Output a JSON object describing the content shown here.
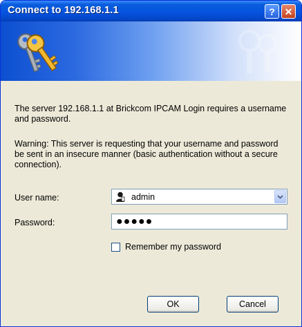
{
  "window": {
    "title": "Connect to 192.168.1.1",
    "help_glyph": "?",
    "close_glyph": "✕"
  },
  "banner": {
    "icon": "keys-icon"
  },
  "message": {
    "line1": "The server 192.168.1.1 at Brickcom IPCAM Login requires a username and password.",
    "warning": "Warning: This server is requesting that your username and password be sent in an insecure manner (basic authentication without a secure connection)."
  },
  "form": {
    "user_label": "User name:",
    "user_value": "admin",
    "password_label": "Password:",
    "password_value": "●●●●●",
    "remember_label": "Remember my password",
    "remember_checked": false
  },
  "buttons": {
    "ok": "OK",
    "cancel": "Cancel"
  },
  "colors": {
    "title_bar": "#0654e0",
    "dialog_bg": "#ece9d8",
    "close_button": "#c3421d"
  }
}
